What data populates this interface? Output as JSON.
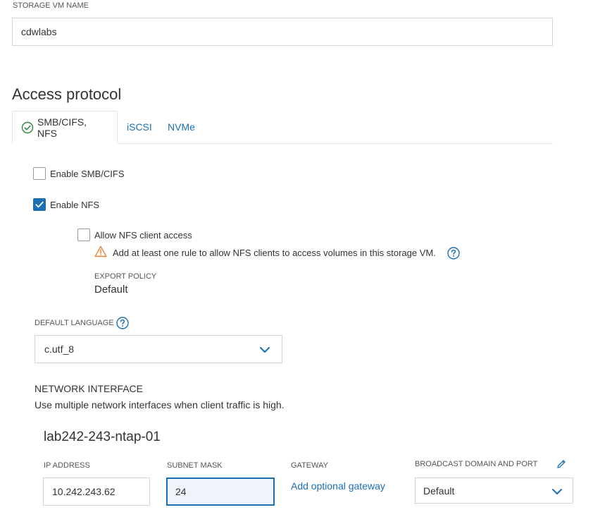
{
  "storage_vm": {
    "label": "STORAGE VM NAME",
    "value": "cdwlabs"
  },
  "access_protocol": {
    "heading": "Access protocol",
    "tabs": [
      {
        "label": "SMB/CIFS, NFS",
        "active": true,
        "icon": "check-circle-icon"
      },
      {
        "label": "iSCSI",
        "active": false
      },
      {
        "label": "NVMe",
        "active": false
      }
    ],
    "enable_smb": {
      "label": "Enable SMB/CIFS",
      "checked": false
    },
    "enable_nfs": {
      "label": "Enable NFS",
      "checked": true
    },
    "allow_nfs_client": {
      "label": "Allow NFS client access",
      "checked": false
    },
    "warning": {
      "icon": "warning-triangle-icon",
      "text": "Add at least one rule to allow NFS clients to access volumes in this storage VM."
    },
    "export_policy": {
      "label": "EXPORT POLICY",
      "value": "Default"
    }
  },
  "default_language": {
    "label": "DEFAULT LANGUAGE",
    "value": "c.utf_8"
  },
  "network_interface": {
    "heading": "NETWORK INTERFACE",
    "description": "Use multiple network interfaces when client traffic is high.",
    "node_name": "lab242-243-ntap-01",
    "ip_address": {
      "label": "IP ADDRESS",
      "value": "10.242.243.62"
    },
    "subnet_mask": {
      "label": "SUBNET MASK",
      "value": "24"
    },
    "gateway": {
      "label": "GATEWAY",
      "link": "Add optional gateway"
    },
    "broadcast_domain": {
      "label": "BROADCAST DOMAIN AND PORT",
      "value": "Default"
    }
  },
  "colors": {
    "accent": "#1a6fb5",
    "warning": "#e8833a",
    "success": "#2e8540",
    "border": "#d5d5d5"
  }
}
